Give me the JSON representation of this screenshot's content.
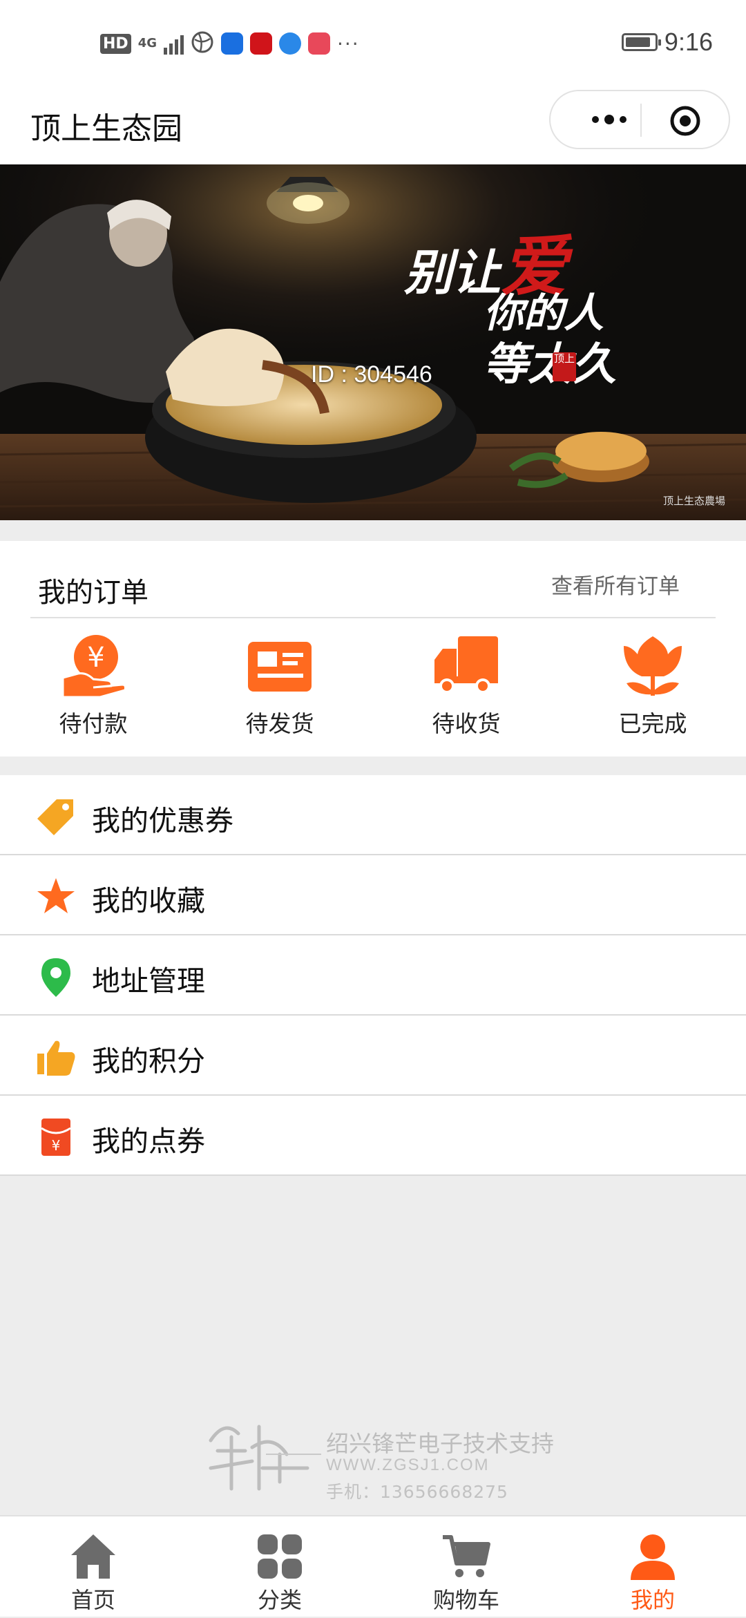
{
  "status_bar": {
    "left_icons": [
      "hd-icon",
      "4g-signal-icon",
      "browser-icon",
      "app-icon",
      "netease-icon",
      "globe-app-icon",
      "shopping-app-icon"
    ],
    "hd": "HD",
    "network": "4G",
    "more": "···",
    "time": "9:16"
  },
  "navbar": {
    "title": "顶上生态园"
  },
  "banner": {
    "id_text": "ID : 304546",
    "line1_a": "别让",
    "line1_b": "爱",
    "line2": "你的人",
    "line3": "等太久",
    "seal": "顶上",
    "watermark": "顶上生态農場"
  },
  "orders": {
    "title": "我的订单",
    "view_all": "查看所有订单",
    "items": [
      {
        "label": "待付款",
        "icon": "payment-hand-icon"
      },
      {
        "label": "待发货",
        "icon": "id-card-icon"
      },
      {
        "label": "待收货",
        "icon": "delivery-truck-icon"
      },
      {
        "label": "已完成",
        "icon": "flower-icon"
      }
    ],
    "accent": "#ff6a1f"
  },
  "menu": {
    "items": [
      {
        "label": "我的优惠券",
        "icon": "coupon-tag-icon"
      },
      {
        "label": "我的收藏",
        "icon": "star-icon"
      },
      {
        "label": "地址管理",
        "icon": "location-pin-icon"
      },
      {
        "label": "我的积分",
        "icon": "thumbs-up-icon"
      },
      {
        "label": "我的点券",
        "icon": "red-envelope-icon"
      }
    ]
  },
  "support": {
    "line1": "绍兴锋芒电子技术支持",
    "line2": "WWW.ZGSJ1.COM",
    "line3": "手机：13656668275"
  },
  "tabbar": {
    "items": [
      {
        "label": "首页",
        "icon": "home-icon"
      },
      {
        "label": "分类",
        "icon": "category-grid-icon"
      },
      {
        "label": "购物车",
        "icon": "cart-icon"
      },
      {
        "label": "我的",
        "icon": "user-icon",
        "active": true
      }
    ],
    "active_color": "#ff5a16",
    "inactive_color": "#666666"
  }
}
